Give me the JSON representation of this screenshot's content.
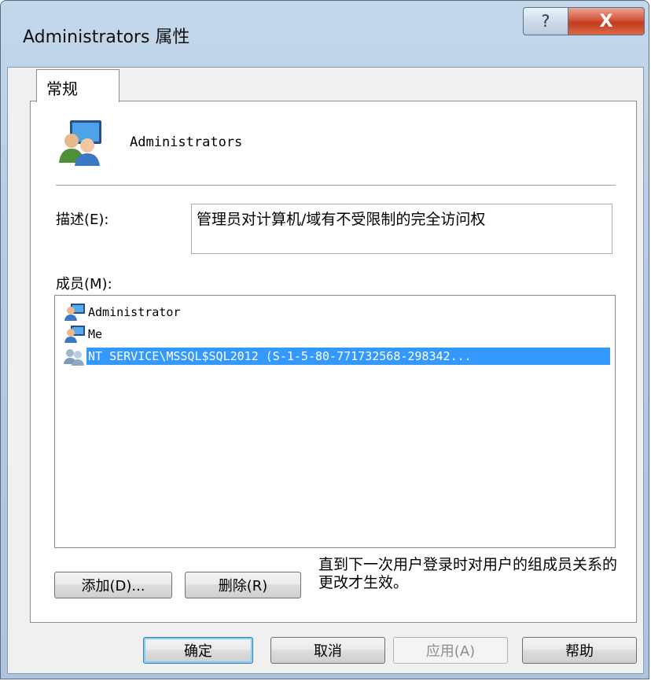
{
  "window": {
    "title": "Administrators 属性",
    "help_glyph": "?",
    "close_glyph": "X"
  },
  "tabs": [
    {
      "label": "常规",
      "selected": true
    }
  ],
  "general": {
    "group_icon": "user-group-icon",
    "group_name": "Administrators",
    "description_label": "描述(E):",
    "description_value": "管理员对计算机/域有不受限制的完全访问权",
    "members_label": "成员(M):",
    "members": [
      {
        "name": "Administrator",
        "icon": "user-icon",
        "selected": false
      },
      {
        "name": "Me",
        "icon": "user-icon",
        "selected": false
      },
      {
        "name": "NT SERVICE\\MSSQL$SQL2012 (S-1-5-80-771732568-298342...",
        "icon": "service-group-icon",
        "selected": true
      }
    ],
    "add_label": "添加(D)...",
    "remove_label": "删除(R)",
    "note": "直到下一次用户登录时对用户的组成员关系的更改才生效。"
  },
  "footer": {
    "ok_label": "确定",
    "cancel_label": "取消",
    "apply_label": "应用(A)",
    "apply_enabled": false,
    "help_label": "帮助"
  },
  "colors": {
    "selection": "#3399ff",
    "close_button": "#c43c1e",
    "frame": "#b6cbe4"
  }
}
